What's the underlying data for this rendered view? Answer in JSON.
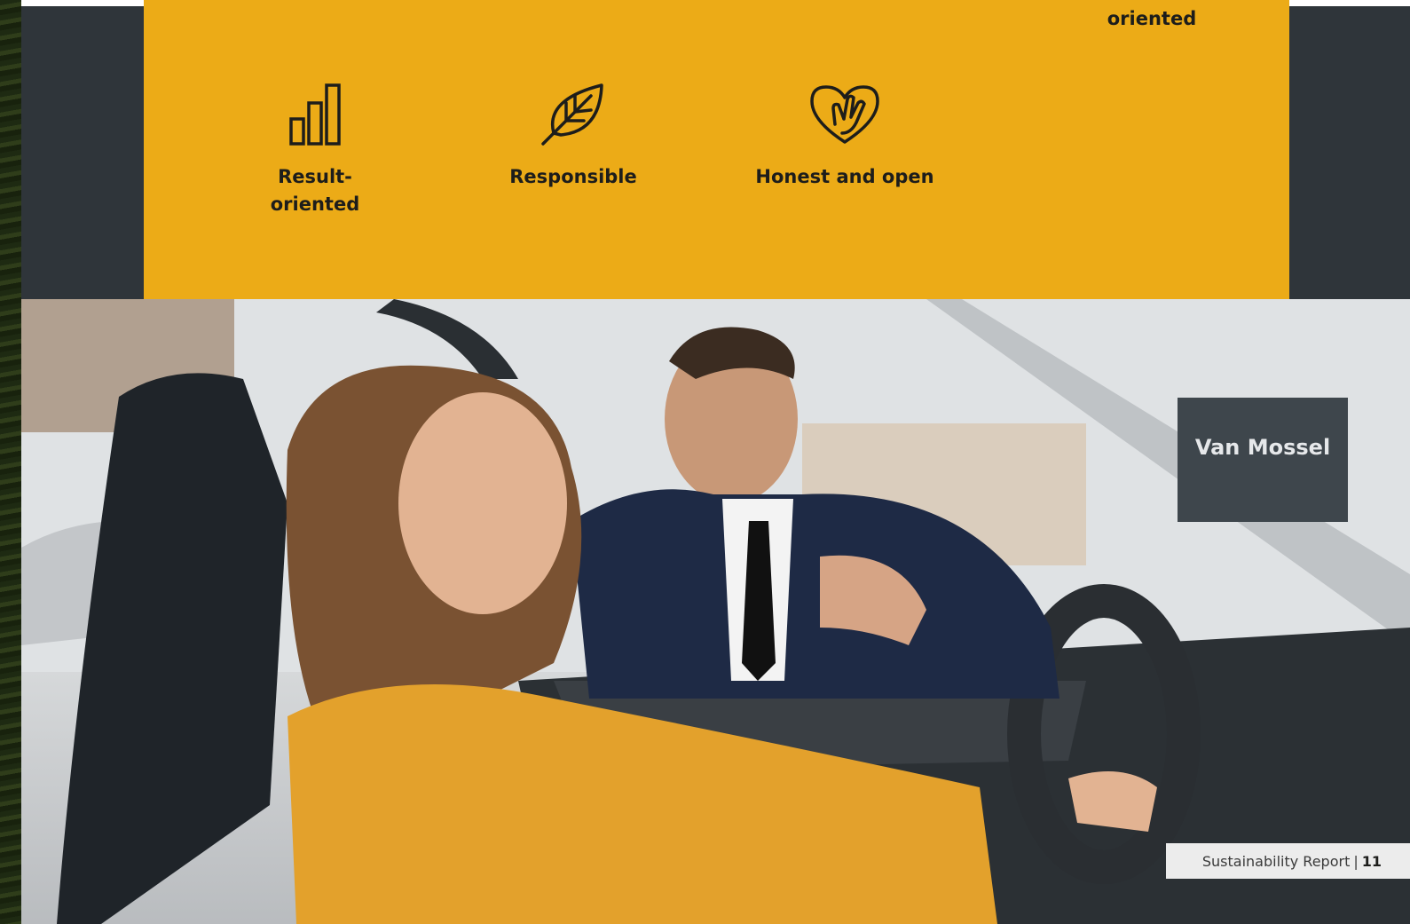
{
  "values": {
    "top_partial_right": "oriented",
    "items": [
      {
        "label": "Result-\noriented",
        "icon": "bar-chart-icon"
      },
      {
        "label": "Responsible",
        "icon": "leaf-icon"
      },
      {
        "label": "Honest and open",
        "icon": "heart-hand-icon"
      }
    ]
  },
  "photo": {
    "sign_text": "Van Mossel"
  },
  "footer": {
    "report_label": "Sustainability Report",
    "separator": "|",
    "page_number": "11"
  },
  "colors": {
    "band": "#ecab17",
    "text": "#1d1d1b",
    "footer_bg": "#ececec"
  }
}
